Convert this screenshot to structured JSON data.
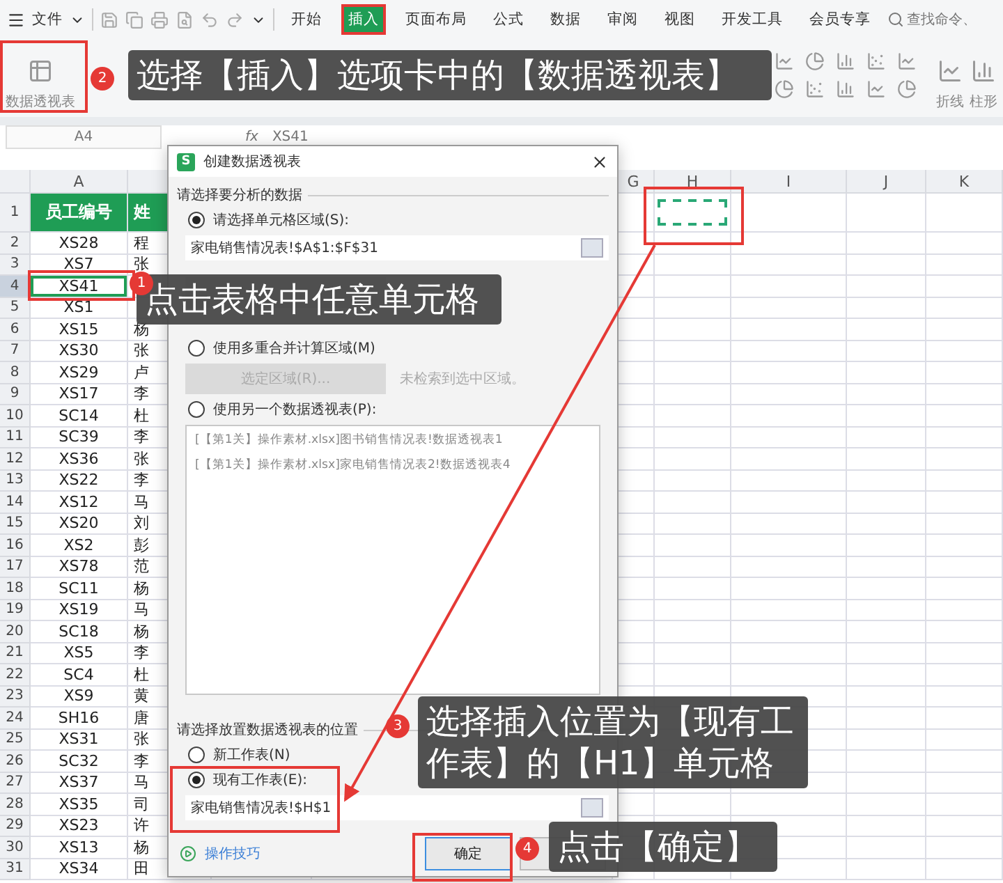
{
  "menu": {
    "file": "文件",
    "tabs": [
      {
        "label": "开始",
        "selected": false
      },
      {
        "label": "插入",
        "selected": true
      },
      {
        "label": "页面布局",
        "selected": false
      },
      {
        "label": "公式",
        "selected": false
      },
      {
        "label": "数据",
        "selected": false
      },
      {
        "label": "审阅",
        "selected": false
      },
      {
        "label": "视图",
        "selected": false
      },
      {
        "label": "开发工具",
        "selected": false
      },
      {
        "label": "会员专享",
        "selected": false
      }
    ],
    "search": {
      "placeholder": "查找命令、"
    }
  },
  "ribbon": {
    "items": [
      "数据透视表"
    ],
    "right_items": [
      "折线",
      "柱形"
    ]
  },
  "formula_bar": {
    "cell_ref": "A4",
    "function_symbol": "fx",
    "value": "XS41"
  },
  "sheet": {
    "columns": [
      "A",
      "G",
      "H",
      "I",
      "J",
      "K"
    ],
    "rows": [
      {
        "number": "1",
        "cells": [
          "员工编号",
          "姓"
        ],
        "selected": false
      },
      {
        "number": "2",
        "cells": [
          "XS28",
          "程"
        ],
        "selected": false
      },
      {
        "number": "3",
        "cells": [
          "XS7",
          "张"
        ],
        "selected": false
      },
      {
        "number": "4",
        "cells": [
          "XS41"
        ],
        "selected": true
      },
      {
        "number": "5",
        "cells": [
          "XS1"
        ],
        "selected": false
      },
      {
        "number": "6",
        "cells": [
          "XS15",
          "杨"
        ],
        "selected": false
      },
      {
        "number": "7",
        "cells": [
          "XS30",
          "张"
        ],
        "selected": false
      },
      {
        "number": "8",
        "cells": [
          "XS29",
          "卢"
        ],
        "selected": false
      },
      {
        "number": "9",
        "cells": [
          "XS17",
          "李"
        ],
        "selected": false
      },
      {
        "number": "10",
        "cells": [
          "SC14",
          "杜"
        ],
        "selected": false
      },
      {
        "number": "11",
        "cells": [
          "SC39",
          "李"
        ],
        "selected": false
      },
      {
        "number": "12",
        "cells": [
          "XS36",
          "张"
        ],
        "selected": false
      },
      {
        "number": "13",
        "cells": [
          "XS22",
          "李"
        ],
        "selected": false
      },
      {
        "number": "14",
        "cells": [
          "XS12",
          "马"
        ],
        "selected": false
      },
      {
        "number": "15",
        "cells": [
          "XS20",
          "刘"
        ],
        "selected": false
      },
      {
        "number": "16",
        "cells": [
          "XS2",
          "彭"
        ],
        "selected": false
      },
      {
        "number": "17",
        "cells": [
          "XS78",
          "范"
        ],
        "selected": false
      },
      {
        "number": "18",
        "cells": [
          "SC11",
          "杨"
        ],
        "selected": false
      },
      {
        "number": "19",
        "cells": [
          "XS19",
          "马"
        ],
        "selected": false
      },
      {
        "number": "20",
        "cells": [
          "SC18",
          "杨"
        ],
        "selected": false
      },
      {
        "number": "21",
        "cells": [
          "XS5",
          "李"
        ],
        "selected": false
      },
      {
        "number": "22",
        "cells": [
          "SC4",
          "杜"
        ],
        "selected": false
      },
      {
        "number": "23",
        "cells": [
          "XS9",
          "黄"
        ],
        "selected": false
      },
      {
        "number": "24",
        "cells": [
          "SH16",
          "唐"
        ],
        "selected": false
      },
      {
        "number": "25",
        "cells": [
          "XS31",
          "张"
        ],
        "selected": false
      },
      {
        "number": "26",
        "cells": [
          "SC32",
          "李"
        ],
        "selected": false
      },
      {
        "number": "27",
        "cells": [
          "XS37",
          "马"
        ],
        "selected": false
      },
      {
        "number": "28",
        "cells": [
          "XS35",
          "司"
        ],
        "selected": false
      },
      {
        "number": "29",
        "cells": [
          "XS23",
          "许"
        ],
        "selected": false
      },
      {
        "number": "30",
        "cells": [
          "XS13",
          "杨"
        ],
        "selected": false
      },
      {
        "number": "31",
        "cells": [
          "XS34",
          "田"
        ],
        "selected": false
      }
    ]
  },
  "dialog": {
    "app_badge": "S",
    "title": "创建数据透视表",
    "source": {
      "heading": "请选择要分析的数据",
      "range_option": {
        "label": "请选择单元格区域(S):",
        "selected": true
      },
      "range_value": "家电销售情况表!$A$1:$F$31",
      "consolidate_option": {
        "label": "使用多重合并计算区域(M)",
        "selected": false
      },
      "consolidate": {
        "button": "选定区域(R)...",
        "status": "未检索到选中区域。"
      },
      "pivot_option": {
        "label": "使用另一个数据透视表(P):",
        "selected": false
      },
      "pivot_list": [
        "[【第1关】操作素材.xlsx]图书销售情况表!数据透视表1",
        "[【第1关】操作素材.xlsx]家电销售情况表2!数据透视表4"
      ]
    },
    "destination": {
      "heading": "请选择放置数据透视表的位置",
      "new_sheet": {
        "label": "新工作表(N)",
        "selected": false
      },
      "existing_sheet": {
        "label": "现有工作表(E):",
        "selected": true
      },
      "value": "家电销售情况表!$H$1"
    },
    "footer": {
      "tips_link": "操作技巧",
      "ok": "确定"
    }
  },
  "annotations": [
    {
      "step": "2",
      "text": "选择【插入】选项卡中的【数据透视表】"
    },
    {
      "step": "1",
      "text": "点击表格中任意单元格"
    },
    {
      "step": "3",
      "text": "选择插入位置为【现有工作表】的【H1】单元格"
    },
    {
      "step": "4",
      "text": "点击【确定】"
    }
  ]
}
